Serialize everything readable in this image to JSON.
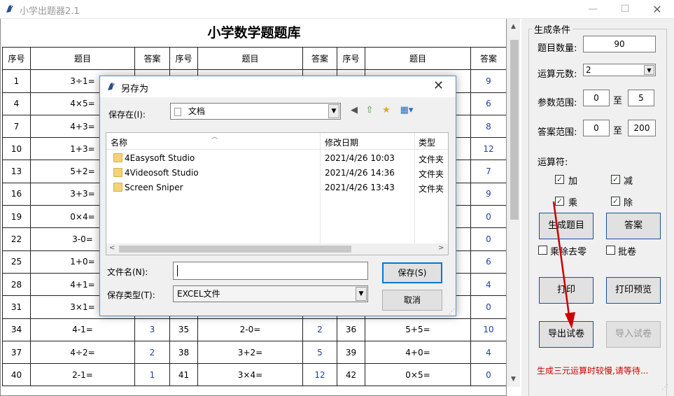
{
  "window": {
    "title": "小学出题器2.1",
    "min_symbol": "—",
    "max_symbol": "☐",
    "close_symbol": "✕"
  },
  "sheet": {
    "title": "小学数学题题库",
    "headers": [
      "序号",
      "题目",
      "答案",
      "序号",
      "题目",
      "答案",
      "序号",
      "题目",
      "答案"
    ],
    "rows": [
      [
        "1",
        "3÷1=",
        "",
        "",
        "",
        "",
        "",
        "",
        "9"
      ],
      [
        "4",
        "4×5=",
        "",
        "",
        "",
        "",
        "",
        "",
        "6"
      ],
      [
        "7",
        "4+3=",
        "",
        "",
        "",
        "",
        "",
        "",
        "8"
      ],
      [
        "10",
        "1+3=",
        "",
        "",
        "",
        "",
        "",
        "",
        "12"
      ],
      [
        "13",
        "5+2=",
        "",
        "",
        "",
        "",
        "",
        "",
        "7"
      ],
      [
        "16",
        "3+3=",
        "",
        "",
        "",
        "",
        "",
        "",
        "9"
      ],
      [
        "19",
        "0×4=",
        "",
        "",
        "",
        "",
        "",
        "",
        "0"
      ],
      [
        "22",
        "3-0=",
        "",
        "",
        "",
        "",
        "",
        "",
        "0"
      ],
      [
        "25",
        "1+0=",
        "",
        "",
        "",
        "",
        "",
        "",
        "6"
      ],
      [
        "28",
        "4+1=",
        "",
        "",
        "",
        "",
        "",
        "",
        "4"
      ],
      [
        "31",
        "3×1=",
        "",
        "",
        "",
        "",
        "",
        "",
        "0"
      ],
      [
        "34",
        "4-1=",
        "3",
        "35",
        "2-0=",
        "2",
        "36",
        "5+5=",
        "10"
      ],
      [
        "37",
        "4÷2=",
        "2",
        "38",
        "3+2=",
        "5",
        "39",
        "4+0=",
        "4"
      ],
      [
        "40",
        "2-1=",
        "1",
        "41",
        "3×4=",
        "12",
        "42",
        "0×5=",
        "0"
      ]
    ]
  },
  "panel": {
    "group_title": "生成条件",
    "count_label": "题目数量:",
    "count_value": "90",
    "operands_label": "运算元数:",
    "operands_value": "2",
    "param_range_label": "参数范围:",
    "param_min": "0",
    "param_to": "至",
    "param_max": "5",
    "answer_range_label": "答案范围:",
    "answer_min": "0",
    "answer_to": "至",
    "answer_max": "200",
    "operators_label": "运算符:",
    "op_add": "加",
    "op_sub": "减",
    "op_mul": "乘",
    "op_div": "除",
    "check_symbol": "✓",
    "generate_btn": "生成题目",
    "answer_btn": "答案",
    "no_zero_label": "乘除去零",
    "batch_label": "批卷",
    "print_btn": "打印",
    "preview_btn": "打印预览",
    "export_btn": "导出试卷",
    "import_btn": "导入试卷",
    "status": "生成三元运算时较慢,请等待..."
  },
  "dialog": {
    "title": "另存为",
    "save_in_label": "保存在(I):",
    "save_in_value": "文档",
    "columns": {
      "name": "名称",
      "modified": "修改日期",
      "type": "类型"
    },
    "files": [
      {
        "name": "4Easysoft Studio",
        "modified": "2021/4/26 10:03",
        "type": "文件夹"
      },
      {
        "name": "4Videosoft Studio",
        "modified": "2021/4/26 14:36",
        "type": "文件夹"
      },
      {
        "name": "Screen Sniper",
        "modified": "2021/4/26 13:43",
        "type": "文件夹"
      }
    ],
    "filename_label": "文件名(N):",
    "filename_value": "",
    "filetype_label": "保存类型(T):",
    "filetype_value": "EXCEL文件",
    "save_btn": "保存(S)",
    "cancel_btn": "取消",
    "close_symbol": "✕"
  },
  "colors": {
    "answer_text": "#1f3ea8",
    "status_text": "#d00000",
    "annotation_arrow": "#cc0000",
    "dialog_border": "#5a8ec9",
    "default_button": "#0078d7"
  }
}
